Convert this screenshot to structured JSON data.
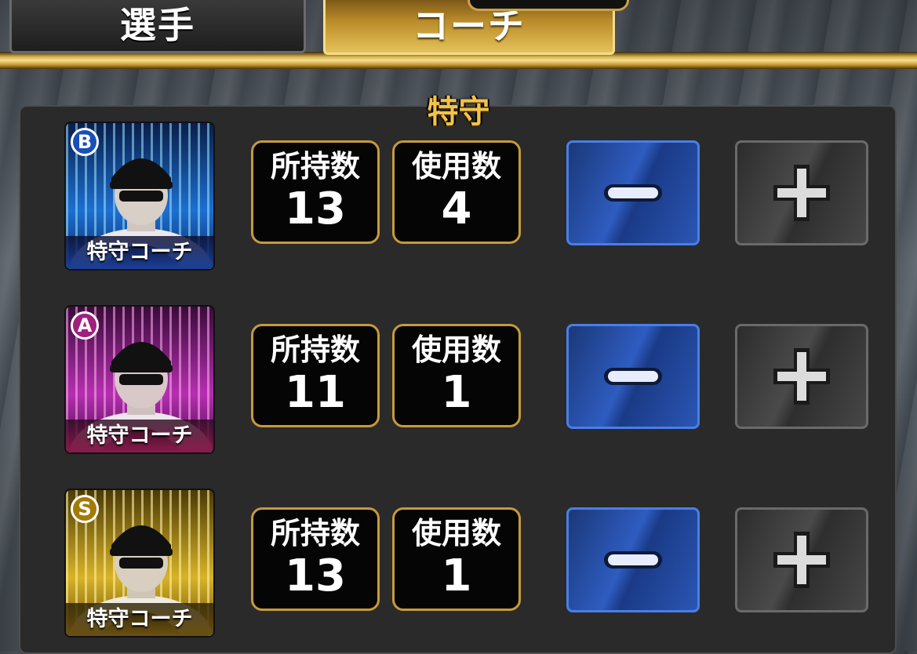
{
  "tabs": [
    {
      "label": "選手",
      "active": false
    },
    {
      "label": "コーチ",
      "active": true
    }
  ],
  "section": {
    "title": "特守"
  },
  "stat_labels": {
    "owned": "所持数",
    "used": "使用数"
  },
  "colors": {
    "gold": "#c69a3c",
    "minus_button": "#2e5cc0",
    "plus_button": "#4a4a4a"
  },
  "coaches": [
    {
      "rank": "B",
      "name": "特守コーチ",
      "owned": "13",
      "used": "4"
    },
    {
      "rank": "A",
      "name": "特守コーチ",
      "owned": "11",
      "used": "1"
    },
    {
      "rank": "S",
      "name": "特守コーチ",
      "owned": "13",
      "used": "1"
    }
  ]
}
